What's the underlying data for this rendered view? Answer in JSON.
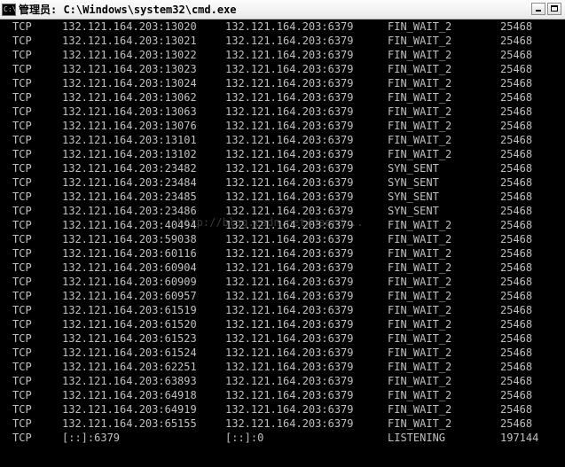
{
  "window": {
    "title": "管理员: C:\\Windows\\system32\\cmd.exe",
    "icon_text": "C:\\."
  },
  "rows": [
    {
      "proto": "TCP",
      "local": "132.121.164.203:13020",
      "foreign": "132.121.164.203:6379",
      "state": "FIN_WAIT_2",
      "pid": "25468"
    },
    {
      "proto": "TCP",
      "local": "132.121.164.203:13021",
      "foreign": "132.121.164.203:6379",
      "state": "FIN_WAIT_2",
      "pid": "25468"
    },
    {
      "proto": "TCP",
      "local": "132.121.164.203:13022",
      "foreign": "132.121.164.203:6379",
      "state": "FIN_WAIT_2",
      "pid": "25468"
    },
    {
      "proto": "TCP",
      "local": "132.121.164.203:13023",
      "foreign": "132.121.164.203:6379",
      "state": "FIN_WAIT_2",
      "pid": "25468"
    },
    {
      "proto": "TCP",
      "local": "132.121.164.203:13024",
      "foreign": "132.121.164.203:6379",
      "state": "FIN_WAIT_2",
      "pid": "25468"
    },
    {
      "proto": "TCP",
      "local": "132.121.164.203:13062",
      "foreign": "132.121.164.203:6379",
      "state": "FIN_WAIT_2",
      "pid": "25468"
    },
    {
      "proto": "TCP",
      "local": "132.121.164.203:13063",
      "foreign": "132.121.164.203:6379",
      "state": "FIN_WAIT_2",
      "pid": "25468"
    },
    {
      "proto": "TCP",
      "local": "132.121.164.203:13076",
      "foreign": "132.121.164.203:6379",
      "state": "FIN_WAIT_2",
      "pid": "25468"
    },
    {
      "proto": "TCP",
      "local": "132.121.164.203:13101",
      "foreign": "132.121.164.203:6379",
      "state": "FIN_WAIT_2",
      "pid": "25468"
    },
    {
      "proto": "TCP",
      "local": "132.121.164.203:13102",
      "foreign": "132.121.164.203:6379",
      "state": "FIN_WAIT_2",
      "pid": "25468"
    },
    {
      "proto": "TCP",
      "local": "132.121.164.203:23482",
      "foreign": "132.121.164.203:6379",
      "state": "SYN_SENT",
      "pid": "25468"
    },
    {
      "proto": "TCP",
      "local": "132.121.164.203:23484",
      "foreign": "132.121.164.203:6379",
      "state": "SYN_SENT",
      "pid": "25468"
    },
    {
      "proto": "TCP",
      "local": "132.121.164.203:23485",
      "foreign": "132.121.164.203:6379",
      "state": "SYN_SENT",
      "pid": "25468"
    },
    {
      "proto": "TCP",
      "local": "132.121.164.203:23486",
      "foreign": "132.121.164.203:6379",
      "state": "SYN_SENT",
      "pid": "25468"
    },
    {
      "proto": "TCP",
      "local": "132.121.164.203:40494",
      "foreign": "132.121.164.203:6379",
      "state": "FIN_WAIT_2",
      "pid": "25468"
    },
    {
      "proto": "TCP",
      "local": "132.121.164.203:59038",
      "foreign": "132.121.164.203:6379",
      "state": "FIN_WAIT_2",
      "pid": "25468"
    },
    {
      "proto": "TCP",
      "local": "132.121.164.203:60116",
      "foreign": "132.121.164.203:6379",
      "state": "FIN_WAIT_2",
      "pid": "25468"
    },
    {
      "proto": "TCP",
      "local": "132.121.164.203:60904",
      "foreign": "132.121.164.203:6379",
      "state": "FIN_WAIT_2",
      "pid": "25468"
    },
    {
      "proto": "TCP",
      "local": "132.121.164.203:60909",
      "foreign": "132.121.164.203:6379",
      "state": "FIN_WAIT_2",
      "pid": "25468"
    },
    {
      "proto": "TCP",
      "local": "132.121.164.203:60957",
      "foreign": "132.121.164.203:6379",
      "state": "FIN_WAIT_2",
      "pid": "25468"
    },
    {
      "proto": "TCP",
      "local": "132.121.164.203:61519",
      "foreign": "132.121.164.203:6379",
      "state": "FIN_WAIT_2",
      "pid": "25468"
    },
    {
      "proto": "TCP",
      "local": "132.121.164.203:61520",
      "foreign": "132.121.164.203:6379",
      "state": "FIN_WAIT_2",
      "pid": "25468"
    },
    {
      "proto": "TCP",
      "local": "132.121.164.203:61523",
      "foreign": "132.121.164.203:6379",
      "state": "FIN_WAIT_2",
      "pid": "25468"
    },
    {
      "proto": "TCP",
      "local": "132.121.164.203:61524",
      "foreign": "132.121.164.203:6379",
      "state": "FIN_WAIT_2",
      "pid": "25468"
    },
    {
      "proto": "TCP",
      "local": "132.121.164.203:62251",
      "foreign": "132.121.164.203:6379",
      "state": "FIN_WAIT_2",
      "pid": "25468"
    },
    {
      "proto": "TCP",
      "local": "132.121.164.203:63893",
      "foreign": "132.121.164.203:6379",
      "state": "FIN_WAIT_2",
      "pid": "25468"
    },
    {
      "proto": "TCP",
      "local": "132.121.164.203:64918",
      "foreign": "132.121.164.203:6379",
      "state": "FIN_WAIT_2",
      "pid": "25468"
    },
    {
      "proto": "TCP",
      "local": "132.121.164.203:64919",
      "foreign": "132.121.164.203:6379",
      "state": "FIN_WAIT_2",
      "pid": "25468"
    },
    {
      "proto": "TCP",
      "local": "132.121.164.203:65155",
      "foreign": "132.121.164.203:6379",
      "state": "FIN_WAIT_2",
      "pid": "25468"
    },
    {
      "proto": "TCP",
      "local": "[::]:6379",
      "foreign": "[::]:0",
      "state": "LISTENING",
      "pid": "197144"
    }
  ],
  "watermark": "http://blog.csdn.net/deerd...",
  "colors": {
    "console_bg": "#000000",
    "console_text": "#c0c0c0"
  }
}
